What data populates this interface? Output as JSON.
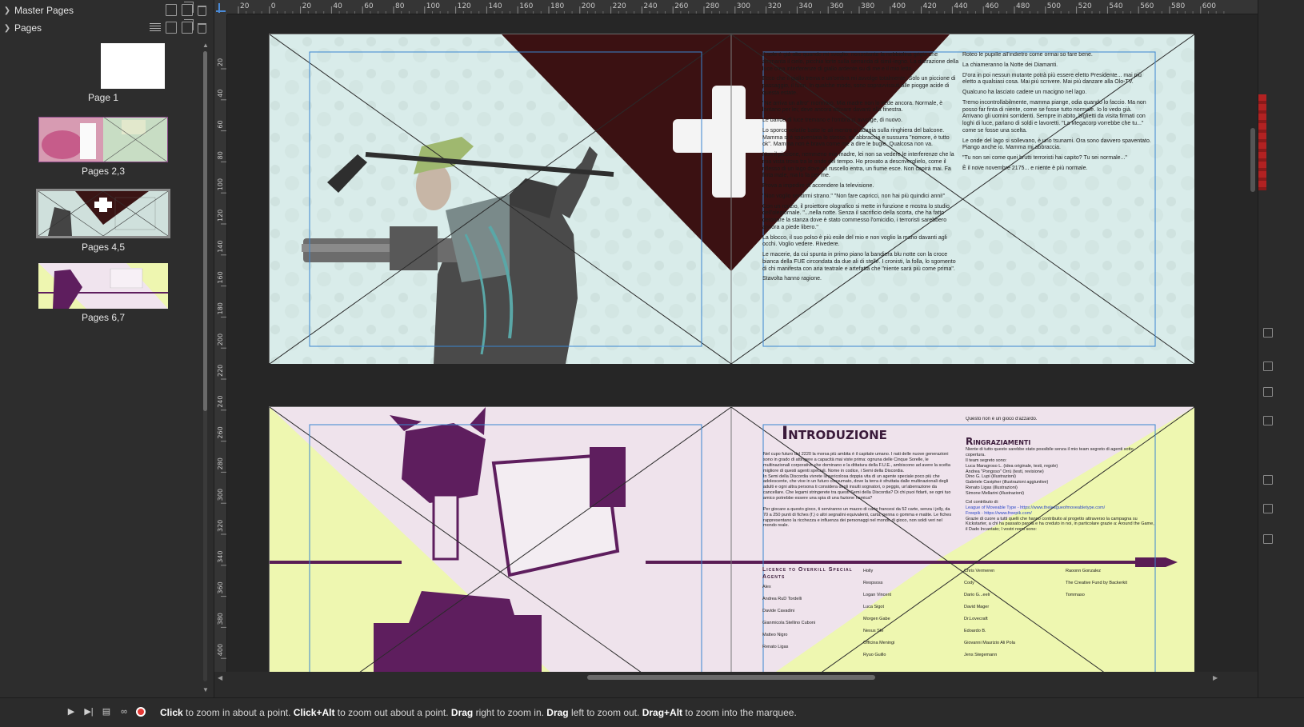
{
  "panel": {
    "master_pages_label": "Master Pages",
    "pages_label": "Pages",
    "thumbnails": [
      {
        "label": "Page 1"
      },
      {
        "label": "Pages 2,3"
      },
      {
        "label": "Pages 4,5"
      },
      {
        "label": "Pages 6,7"
      }
    ]
  },
  "ruler_top_ticks": [
    "20",
    "0",
    "20",
    "40",
    "60",
    "80",
    "100",
    "120",
    "140",
    "160",
    "180",
    "200",
    "220",
    "240",
    "260",
    "280",
    "300",
    "320",
    "340",
    "360",
    "380",
    "400",
    "420",
    "440",
    "460",
    "480",
    "500",
    "520",
    "540",
    "560",
    "580",
    "600"
  ],
  "ruler_left_ticks": [
    "20",
    "40",
    "60",
    "80",
    "100",
    "120",
    "140",
    "160",
    "180",
    "200",
    "220",
    "240",
    "260",
    "280",
    "300",
    "320",
    "340",
    "360",
    "380",
    "400"
  ],
  "status": {
    "hint_parts": [
      {
        "bold": "Click",
        "text": " to zoom in about a point. "
      },
      {
        "bold": "Click+Alt",
        "text": " to zoom out about a point. "
      },
      {
        "bold": "Drag",
        "text": " right to zoom in. "
      },
      {
        "bold": "Drag",
        "text": " left to zoom out. "
      },
      {
        "bold": "Drag+Alt",
        "text": " to zoom into the marquee."
      }
    ]
  },
  "spread1": {
    "right_col1": [
      "Il sole è già alto quando mi sveglio; nonostante la nebbiolina grigia che ammanta il cielo, picchia forte sulla serranda di simil-legno. La distrazione della luce crea interferenze di giallo ardente su di me e il mio letto.",
      "Ecco che il giallo trema e un'ombra mi avvolge totalmente. Solo un piccione di passaggio, il fuori. In qualche modo, sono sopravvissuti alle piogge acide di questa estate.",
      "\"Ne arriva un altro\" mormoro. Mia madre non lo vede ancora. Normale, è lontano per lei; deve ancora attivare davanti alla finestra.",
      "Le bande di luce tremano e l'ombra ci avvolge, di nuovo.",
      "Lo sporco volatile batte le ali mentre si adagia sulla ringhiera del balcone. Mamma si è spaventata lo stesso, mi abbraccia e sussurra \"nomore, è tutto ok\". Mamma non è brava come me a dire le bugie. Qualcosa non va.",
      "Non il piccione, nemmeno mia madre, lei non sa vedere le interferenze che la mia vista trova tra le onde del tempo. Ho provato a descriverglielo, come il riflesso di un lago dove un ruscello entra, un fiume esce. Non capirà mai. Fa finta male, ma lo fa per me.",
      "Prova a impedire di accendere la televisione.",
      "\"Non voglio sentirmi strano.\" \"Non fare capricci, non hai più quindici anni!\"",
      "Con un ronzio, il proiettore olografico si mette in funzione e mostra lo studio dell'olegiornale. \"...nella notte. Senza il sacrificio della scorta, che ha fatto detonare la stanza dove è stato commesso l'omicidio, i terroristi sarebbero ancora a piede libero.\"",
      "La blocco, il suo polso è più esile del mio e non voglio la mano davanti agli occhi. Voglio vedere. Rivedere.",
      "Le macerie, da cui spunta in primo piano la bandiera blu notte con la croce bianca della FUE circondata da due ali di stelle. I cronisti, la folla, lo sgomento di chi manifesta con aria teatrale e artefatta che \"niente sarà più come prima\".",
      "Stavolta hanno ragione."
    ],
    "right_col2": [
      "Roteo le pupille all'indietro come ormai so fare bene.",
      "La chiameranno la Notte dei Diamanti.",
      "D'ora in poi nessun mutante potrà più essere eletto Presidente... mai più eletto a qualsiasi cosa. Mai più scrivere. Mai più danzare alla Olo-TV.",
      "Qualcuno ha lasciato cadere un macigno nel lago.",
      "Tremo incontrollabilmente, mamma piange, odia quando lo faccio. Ma non posso far finta di niente, come se fosse tutto normale. Io lo vedo già. Arrivano gli uomini sorridenti. Sempre in abito, biglietti da visita firmati con loghi di luce, parlano di soldi e lavoretti. \"La Megacorp vorrebbe che tu...\" come se fosse una scelta.",
      "Le onde del lago si sollevano, è uno tsunami. Ora sono davvero spaventato. Piango anche io. Mamma mi abbraccia.",
      "\"Tu non sei come quei brutti terroristi hai capito? Tu sei normale...\"",
      "È il nove novembre 2175... e niente è più normale."
    ]
  },
  "spread2": {
    "title": "Introduzione",
    "intro_text": "Nel cupo futuro del 2220 la morsa più ambita è il capitale umano. I nati delle nuove generazioni sono in grado di attingere a capacità mai viste prima: ognuna delle Cinque Sorelle, le multinazionali corporative che dominano e la dittatura della F.U.E., ambiscono ad avere la scelta migliore di questi agenti speciali. Nome in codice, i Semi della Discordia.",
    "intro_text2": "In Semi della Discordia vivrete la pericolosa doppia vita di un agente speciale poco più che adolescente, che vive in un futuro consumato, dove la terra è sfruttata dalle multinazionali degli adulti e ogni altra persona ti considera degli insulti sognatori, o peggio, un'aberrazione da cancellare. Che legami stringerete tra questi Semi della Discordia? Di chi puoi fidarti, se ogni tuo amico potrebbe essere una spia di una fazione nemica?",
    "intro_text3": "Per giocare a questo gioco, ti serviranno un mazzo di carte francesi da 52 carte, senza i jolly, da 70 a 250 punti di fiches (f.) o altri segnalini equivalenti, carta, penna o gomma e matite. Le fiches rappresentano la ricchezza e influenza dei personaggi nel mondo di gioco, non soldi veri nel mondo reale.",
    "not_game": "Questo non è un gioco d'azzardo.",
    "thanks_title": "Ringraziamenti",
    "thanks_text": "Niente di tutto questo sarebbe stato possibile senza il mio team segreto di agenti sotto copertura.",
    "team_head": "Il team segreto sono:",
    "team": [
      "Luca Maragroso L. (idea originale, testi, regole)",
      "Andrea \"Pongoso\" Orrù (testi, revisione)",
      "Dino G. Lupi (illustrazioni)",
      "Gabriele Cavipher (illustrazioni aggiuntive)",
      "Renato Ligas (illustrazioni)",
      "Simone Mellarini (illustrazioni)"
    ],
    "contrib_head": "Col contributo di:",
    "contrib": [
      "League of Moveable Type - https://www.theleagueofmoveabletype.com/",
      "Freepik - https://www.freepik.com/"
    ],
    "grazie": "Grazie di cuore a tutti quelli che hanno contribuito al progetto attraverso la campagna su Kickstarter, a chi ha passato parola e ha creduto in noi, in particolare grazie a: Around the Game, il Dado Incantato; I vostri nomi sono:",
    "special_head": "Licence to Overkill Special Agents",
    "names_col1": [
      "Alex",
      "Andrea RuD Tordelli",
      "Davide Cavadini",
      "Gianmicola Stellino Cuboni",
      "Matteo Nigro",
      "Renato Ligas"
    ],
    "names_col2": [
      "Holly",
      "Reopsoss",
      "Logan Vincent",
      "Luca Sigot",
      "Morgen Gabe",
      "Nexus Ste",
      "Officina Meningi",
      "Ryuo Guillo"
    ],
    "names_col3": [
      "Chris Vermeren",
      "Cody",
      "Dario G...eelr",
      "David Mager",
      "Dr.Lovecraft",
      "Edoardo B.",
      "Giovanni Maurizio Ali Pola",
      "Jens Stegemann"
    ],
    "names_col4": [
      "Raoonn Gonzalez",
      "The Creative Fund by Backerkit",
      "Tommaso"
    ]
  }
}
